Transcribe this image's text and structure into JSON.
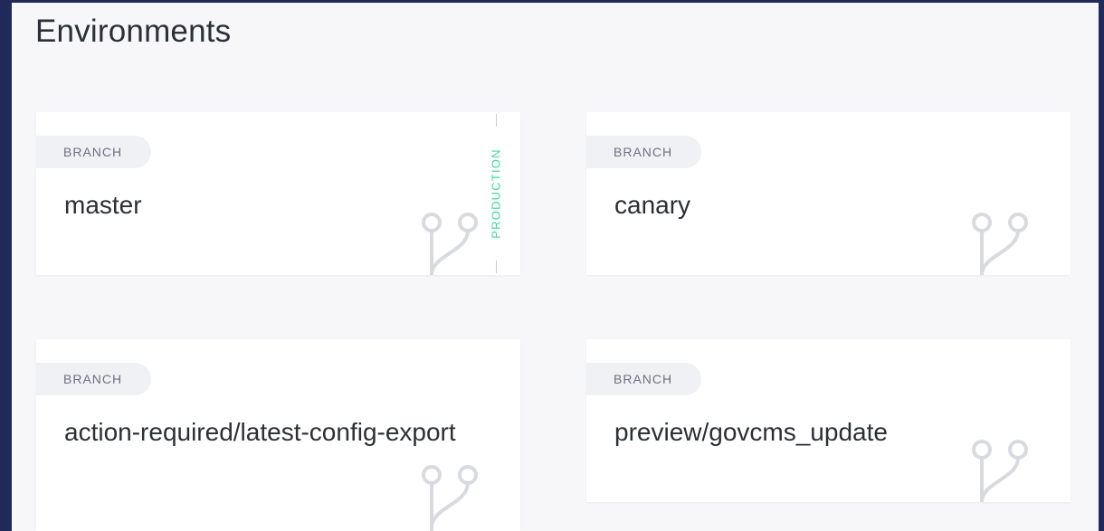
{
  "page": {
    "title": "Environments"
  },
  "environments": [
    {
      "type_label": "BRANCH",
      "name": "master",
      "badge": "PRODUCTION"
    },
    {
      "type_label": "BRANCH",
      "name": "canary"
    },
    {
      "type_label": "BRANCH",
      "name": "action-required/latest-config-export"
    },
    {
      "type_label": "BRANCH",
      "name": "preview/govcms_update"
    }
  ],
  "colors": {
    "background": "#1f2a5a",
    "panel": "#f7f7fa",
    "card": "#ffffff",
    "production_accent": "#3fd4a0"
  },
  "icons": {
    "card_decoration": "git-branch-icon"
  }
}
